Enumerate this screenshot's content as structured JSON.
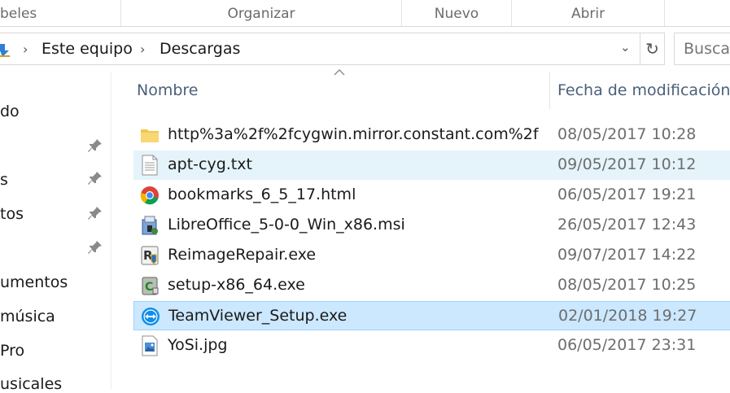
{
  "ribbon": {
    "groups": [
      "beles",
      "Organizar",
      "Nuevo",
      "Abrir"
    ]
  },
  "address": {
    "crumbs": [
      "Este equipo",
      "Descargas"
    ],
    "search_placeholder": "Buscar"
  },
  "nav": {
    "items": [
      "do",
      "s",
      "tos",
      "umentos",
      "música",
      "Pro",
      "usicales"
    ]
  },
  "columns": {
    "name": "Nombre",
    "date": "Fecha de modificación"
  },
  "files": [
    {
      "name": "http%3a%2f%2fcygwin.mirror.constant.com%2f",
      "date": "08/05/2017 10:28",
      "icon": "folder-icon"
    },
    {
      "name": "apt-cyg.txt",
      "date": "09/05/2017 10:12",
      "icon": "text-file-icon"
    },
    {
      "name": "bookmarks_6_5_17.html",
      "date": "06/05/2017 19:21",
      "icon": "chrome-icon"
    },
    {
      "name": "LibreOffice_5-0-0_Win_x86.msi",
      "date": "26/05/2017 12:43",
      "icon": "installer-icon"
    },
    {
      "name": "ReimageRepair.exe",
      "date": "09/07/2017 14:22",
      "icon": "reimage-icon"
    },
    {
      "name": "setup-x86_64.exe",
      "date": "08/05/2017 10:25",
      "icon": "cygwin-setup-icon"
    },
    {
      "name": "TeamViewer_Setup.exe",
      "date": "02/01/2018 19:27",
      "icon": "teamviewer-icon"
    },
    {
      "name": "YoSi.jpg",
      "date": "06/05/2017 23:31",
      "icon": "image-file-icon"
    }
  ],
  "colors": {
    "hover_row": "#e5f3fb",
    "selected_row": "#cce8ff",
    "selected_border": "#99d1ff",
    "header_text": "#4c607a"
  }
}
